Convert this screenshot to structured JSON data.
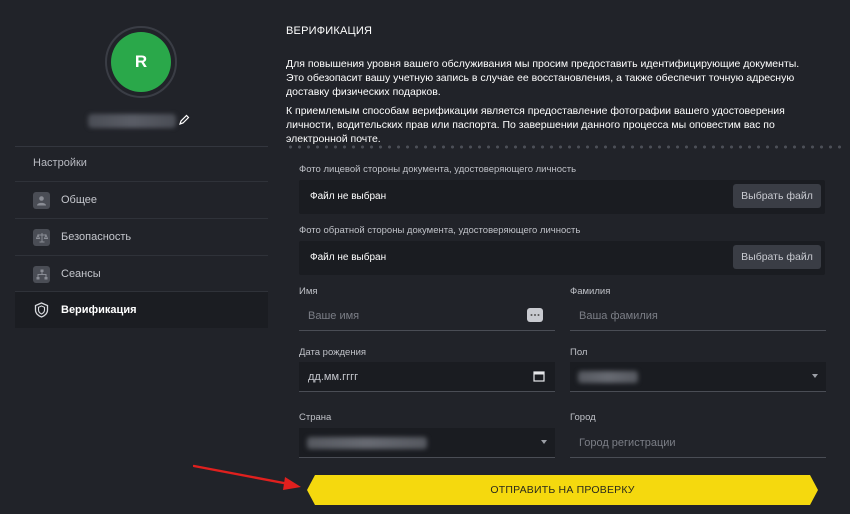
{
  "profile": {
    "avatar_letter": "R",
    "avatar_color": "#2aa84a"
  },
  "sidebar": {
    "section_title": "Настройки",
    "items": [
      {
        "label": "Общее",
        "icon": "user-icon",
        "active": false
      },
      {
        "label": "Безопасность",
        "icon": "scales-icon",
        "active": false
      },
      {
        "label": "Сеансы",
        "icon": "network-icon",
        "active": false
      },
      {
        "label": "Верификация",
        "icon": "shield-icon",
        "active": true
      }
    ]
  },
  "main": {
    "title": "ВЕРИФИКАЦИЯ",
    "paragraph1": "Для повышения уровня вашего обслуживания мы просим предоставить идентифицирующие документы. Это обезопасит вашу учетную запись в случае ее восстановления, а также обеспечит точную адресную доставку физических подарков.",
    "paragraph2": "К приемлемым способам верификации является предоставление фотографии вашего удостоверения личности, водительских прав или паспорта. По завершении данного процесса мы оповестим вас по электронной почте.",
    "front_doc": {
      "label": "Фото лицевой стороны документа, удостоверяющего личность",
      "status": "Файл не выбран",
      "button": "Выбрать файл"
    },
    "back_doc": {
      "label": "Фото обратной стороны документа, удостоверяющего личность",
      "status": "Файл не выбран",
      "button": "Выбрать файл"
    },
    "first_name": {
      "label": "Имя",
      "placeholder": "Ваше имя"
    },
    "last_name": {
      "label": "Фамилия",
      "placeholder": "Ваша фамилия"
    },
    "birth_date": {
      "label": "Дата рождения",
      "placeholder": "дд.мм.гггг"
    },
    "gender": {
      "label": "Пол"
    },
    "country": {
      "label": "Страна"
    },
    "city": {
      "label": "Город",
      "placeholder": "Город регистрации"
    },
    "submit_label": "ОТПРАВИТЬ НА ПРОВЕРКУ",
    "accent_color": "#f5d90e"
  }
}
